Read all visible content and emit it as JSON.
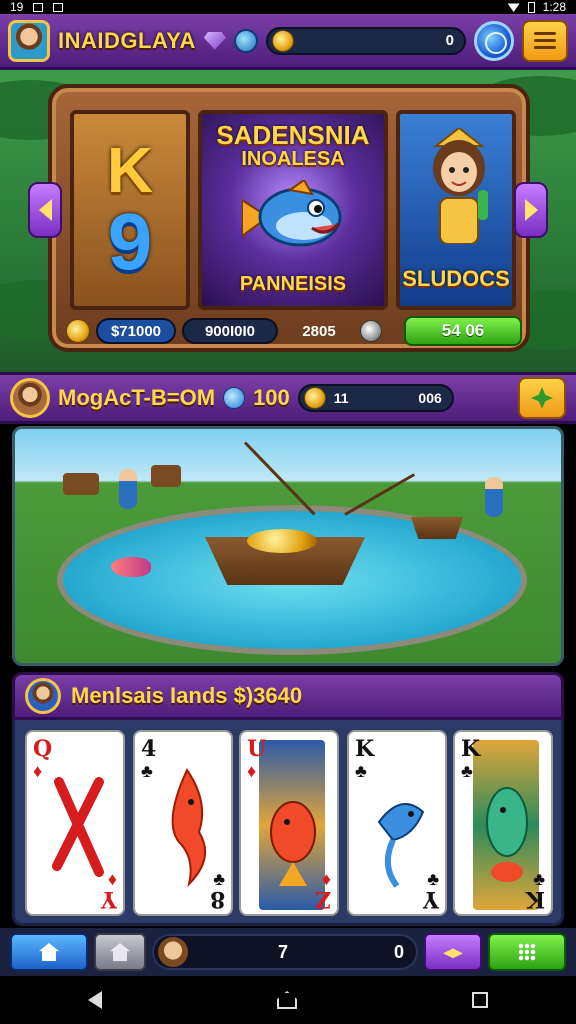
{
  "status_bar": {
    "left": "19",
    "time": "1:28"
  },
  "top_hud": {
    "player_name": "INAIDGLAYA",
    "currency_value": "0"
  },
  "banner": {
    "left_panel": {
      "letter": "K",
      "number": "9"
    },
    "mid_panel": {
      "title_line1": "SADENSNIA",
      "title_line2": "INOALESA",
      "footer": "PANNEISIS"
    },
    "right_panel": {
      "label": "SLUDOCS"
    },
    "stats": {
      "value1": "$71000",
      "value2": "900I0I0",
      "value3": "2805",
      "button": "54 06"
    }
  },
  "mission": {
    "title": "MogAcT-B=OM",
    "number": "100",
    "bar_value1": "11",
    "bar_value2": "006"
  },
  "cards_section": {
    "title": "Menlsais Iands $)3640",
    "cards": [
      {
        "rank": "Q",
        "suit": "♦",
        "color": "red",
        "rank_bottom": "Y"
      },
      {
        "rank": "4",
        "suit": "♣",
        "color": "black",
        "rank_bottom": "8"
      },
      {
        "rank": "U",
        "suit": "♦",
        "color": "red",
        "rank_bottom": "Z"
      },
      {
        "rank": "K",
        "suit": "♣",
        "color": "black",
        "rank_bottom": "Y"
      },
      {
        "rank": "K",
        "suit": "♣",
        "color": "black",
        "rank_bottom": "K"
      }
    ]
  },
  "bottom_bar": {
    "value1": "7",
    "value2": "0"
  },
  "colors": {
    "hud_purple": "#7b3fa8",
    "gold_text": "#ffd84a",
    "green_button": "#2ea312",
    "blue_button": "#1c62c8"
  },
  "icons": [
    "avatar",
    "gem-icon",
    "globe-icon",
    "coin-icon",
    "menu-icon",
    "arrow-left-icon",
    "arrow-right-icon",
    "clover-icon",
    "home-icon",
    "swap-icon",
    "grid-icon",
    "back-icon",
    "recents-icon"
  ]
}
